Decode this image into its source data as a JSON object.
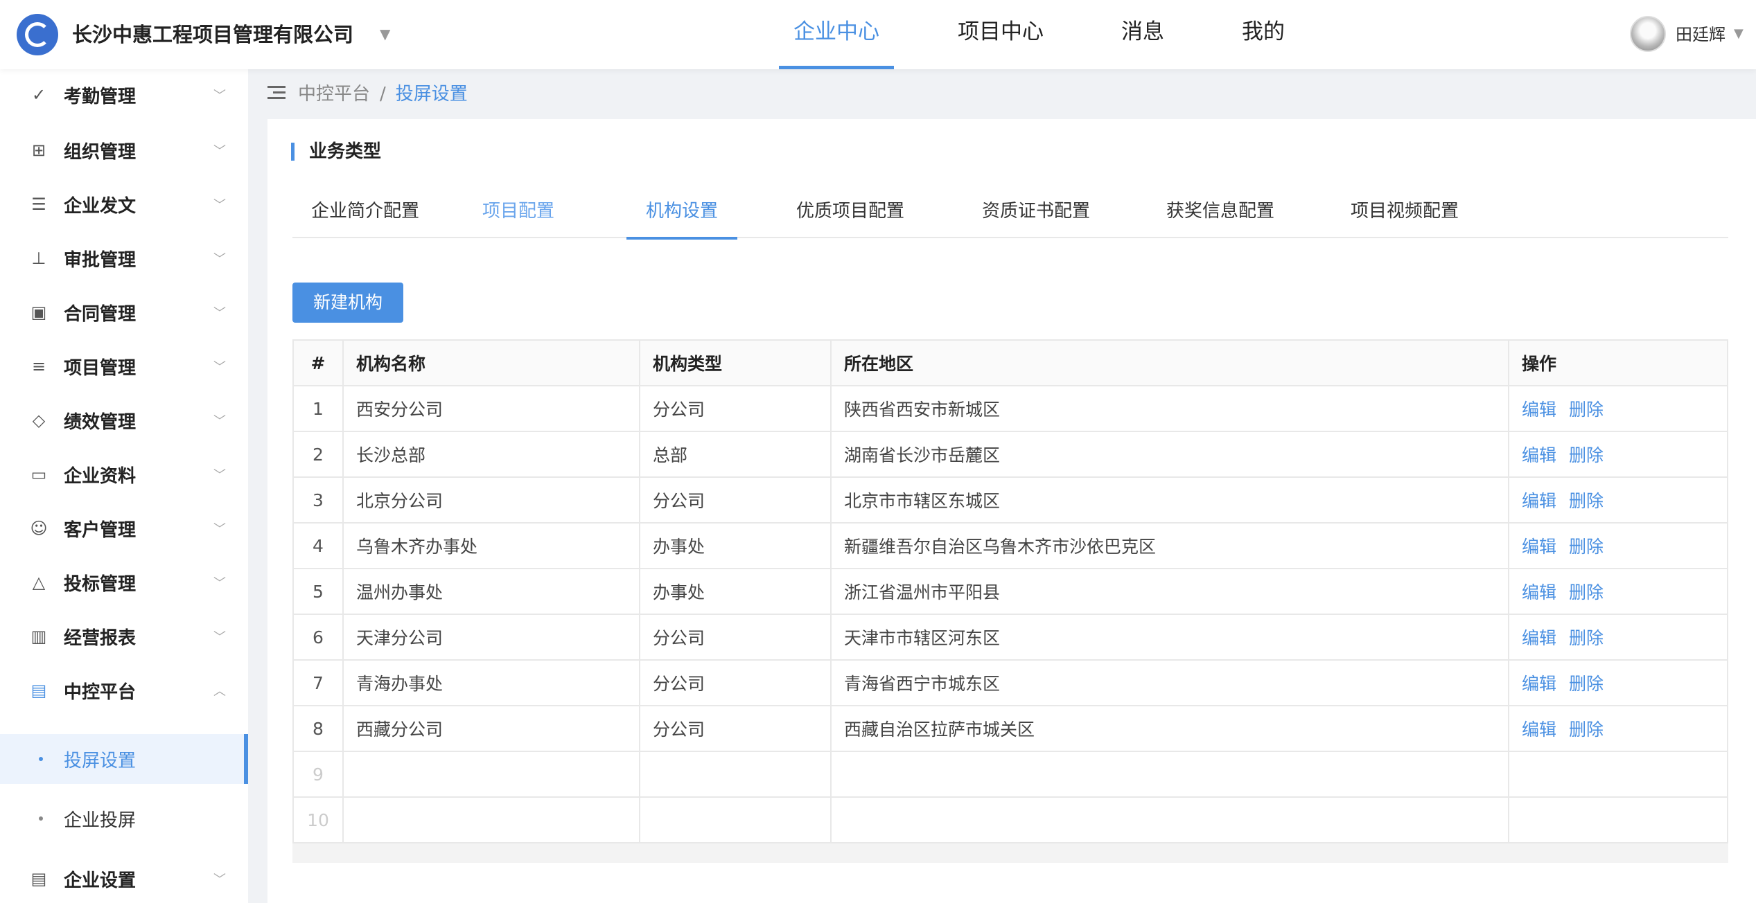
{
  "header": {
    "company": "长沙中惠工程项目管理有限公司",
    "nav": [
      "企业中心",
      "项目中心",
      "消息",
      "我的"
    ],
    "active_nav": 0,
    "username": "田廷辉"
  },
  "sidebar": {
    "items": [
      {
        "label": "考勤管理",
        "icon": "check-circle-icon",
        "expanded": false
      },
      {
        "label": "组织管理",
        "icon": "org-chart-icon",
        "expanded": false
      },
      {
        "label": "企业发文",
        "icon": "document-icon",
        "expanded": false
      },
      {
        "label": "审批管理",
        "icon": "stamp-icon",
        "expanded": false
      },
      {
        "label": "合同管理",
        "icon": "contract-icon",
        "expanded": false
      },
      {
        "label": "项目管理",
        "icon": "list-icon",
        "expanded": false
      },
      {
        "label": "绩效管理",
        "icon": "diamond-icon",
        "expanded": false
      },
      {
        "label": "企业资料",
        "icon": "folder-icon",
        "expanded": false
      },
      {
        "label": "客户管理",
        "icon": "users-icon",
        "expanded": false
      },
      {
        "label": "投标管理",
        "icon": "triangle-icon",
        "expanded": false
      },
      {
        "label": "经营报表",
        "icon": "bar-chart-icon",
        "expanded": false
      },
      {
        "label": "中控平台",
        "icon": "building-icon",
        "expanded": true
      }
    ],
    "subitems": [
      {
        "label": "投屏设置",
        "active": true
      },
      {
        "label": "企业投屏",
        "active": false
      }
    ],
    "last_item": {
      "label": "企业设置",
      "icon": "building-icon"
    }
  },
  "breadcrumb": {
    "parent": "中控平台",
    "separator": "/",
    "current": "投屏设置"
  },
  "section": {
    "title": "业务类型"
  },
  "tabs": {
    "items": [
      "企业简介配置",
      "项目配置",
      "机构设置",
      "优质项目配置",
      "资质证书配置",
      "获奖信息配置",
      "项目视频配置"
    ],
    "active": 2
  },
  "toolbar": {
    "new_label": "新建机构"
  },
  "table": {
    "columns": [
      "#",
      "机构名称",
      "机构类型",
      "所在地区",
      "操作"
    ],
    "actions": [
      "编辑",
      "删除"
    ],
    "rows": [
      {
        "idx": "1",
        "name": "西安分公司",
        "type": "分公司",
        "region": "陕西省西安市新城区"
      },
      {
        "idx": "2",
        "name": "长沙总部",
        "type": "总部",
        "region": "湖南省长沙市岳麓区"
      },
      {
        "idx": "3",
        "name": "北京分公司",
        "type": "分公司",
        "region": "北京市市辖区东城区"
      },
      {
        "idx": "4",
        "name": "乌鲁木齐办事处",
        "type": "办事处",
        "region": "新疆维吾尔自治区乌鲁木齐市沙依巴克区"
      },
      {
        "idx": "5",
        "name": "温州办事处",
        "type": "办事处",
        "region": "浙江省温州市平阳县"
      },
      {
        "idx": "6",
        "name": "天津分公司",
        "type": "分公司",
        "region": "天津市市辖区河东区"
      },
      {
        "idx": "7",
        "name": "青海办事处",
        "type": "分公司",
        "region": "青海省西宁市城东区"
      },
      {
        "idx": "8",
        "name": "西藏分公司",
        "type": "分公司",
        "region": "西藏自治区拉萨市城关区"
      }
    ],
    "empty_rows": [
      "9",
      "10"
    ]
  },
  "colors": {
    "accent": "#4a90e2",
    "active_bg": "#ecf3fd"
  }
}
